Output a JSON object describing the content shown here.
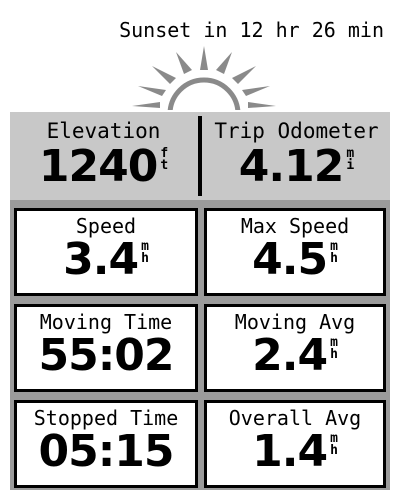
{
  "sunset": {
    "text": "Sunset in 12 hr 26 min"
  },
  "header_fields": [
    {
      "label": "Elevation",
      "value": "1240",
      "unit_top": "f",
      "unit_bottom": "t"
    },
    {
      "label": "Trip Odometer",
      "value": "4.12",
      "unit_top": "m",
      "unit_bottom": "i"
    }
  ],
  "fields": [
    {
      "label": "Speed",
      "value": "3.4",
      "unit_top": "m",
      "unit_bottom": "h"
    },
    {
      "label": "Max Speed",
      "value": "4.5",
      "unit_top": "m",
      "unit_bottom": "h"
    },
    {
      "label": "Moving Time",
      "value": "55:02"
    },
    {
      "label": "Moving Avg",
      "value": "2.4",
      "unit_top": "m",
      "unit_bottom": "h"
    },
    {
      "label": "Stopped Time",
      "value": "05:15"
    },
    {
      "label": "Overall Avg",
      "value": "1.4",
      "unit_top": "m",
      "unit_bottom": "h"
    }
  ],
  "colors": {
    "frame": "#9b9b9b",
    "header_bg": "#c8c8c8",
    "sun": "#8a8a8a"
  },
  "icons": {
    "sun": "sun-icon"
  }
}
